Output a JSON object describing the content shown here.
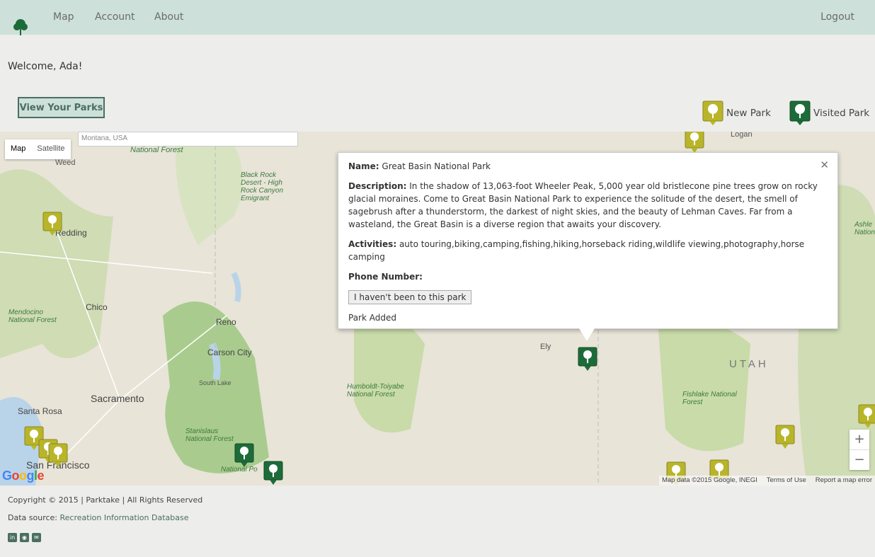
{
  "nav": {
    "items": [
      "Map",
      "Account",
      "About"
    ],
    "logout": "Logout"
  },
  "welcome": "Welcome, Ada!",
  "view_parks_button": "View Your Parks",
  "legend": {
    "new_park": "New Park",
    "visited_park": "Visited Park",
    "new_color": "#b9b52a",
    "visited_color": "#1e6b3a"
  },
  "map": {
    "search_placeholder": "Montana, USA",
    "type_options": [
      "Map",
      "Satellite"
    ],
    "labels": {
      "national_forest_top": "National Forest",
      "weed": "Weed",
      "black_rock": "Black Rock Desert - High Rock Canyon Emigrant",
      "redding": "Redding",
      "chico": "Chico",
      "mendocino": "Mendocino National Forest",
      "reno": "Reno",
      "carson_city": "Carson City",
      "south_lake": "South Lake",
      "sacramento": "Sacramento",
      "santa_rosa": "Santa Rosa",
      "san_francisco": "San Francisco",
      "stanislaus": "Stanislaus National Forest",
      "national_po": "National Po",
      "humboldt": "Humboldt-Toiyabe National Forest",
      "ely": "Ely",
      "utah": "UTAH",
      "fishlake": "Fishlake National Forest",
      "logan": "Logan",
      "ashley": "Ashle National"
    },
    "zoom_in": "+",
    "zoom_out": "−",
    "google": "Google",
    "attribution": {
      "data": "Map data ©2015 Google, INEGI",
      "terms": "Terms of Use",
      "report": "Report a map error"
    }
  },
  "popup": {
    "name_label": "Name:",
    "name": "Great Basin National Park",
    "description_label": "Description:",
    "description": "In the shadow of 13,063-foot Wheeler Peak, 5,000 year old bristlecone pine trees grow on rocky glacial moraines. Come to Great Basin National Park to experience the solitude of the desert, the smell of sagebrush after a thunderstorm, the darkest of night skies, and the beauty of Lehman Caves. Far from a wasteland, the Great Basin is a diverse region that awaits your discovery.",
    "activities_label": "Activities:",
    "activities": "auto touring,biking,camping,fishing,hiking,horseback riding,wildlife viewing,photography,horse camping",
    "phone_label": "Phone Number:",
    "toggle_button": "I haven't been to this park",
    "status": "Park Added",
    "close": "✕"
  },
  "footer": {
    "copyright": "Copyright © 2015 | Parktake | All Rights Reserved",
    "data_source_label": "Data source:",
    "data_source_link": "Recreation Information Database"
  },
  "social_icons": [
    "linkedin-icon",
    "github-icon",
    "email-icon"
  ]
}
